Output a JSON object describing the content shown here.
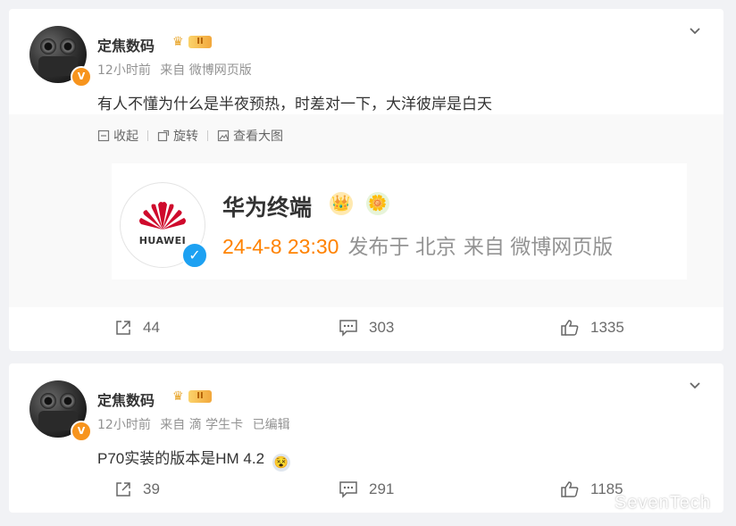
{
  "posts": [
    {
      "author": "定焦数码",
      "level_badge": "II",
      "verify_badge": "V",
      "meta": {
        "time": "12小时前",
        "source": "来自 微博网页版"
      },
      "text": "有人不懂为什么是半夜预热，时差对一下，大洋彼岸是白天",
      "toolbar": {
        "collect": "收起",
        "rotate": "旋转",
        "view_large": "查看大图"
      },
      "embed": {
        "name": "华为终端",
        "logo_text": "HUAWEI",
        "time": "24-4-8 23:30",
        "location": "发布于 北京",
        "source": "来自 微博网页版"
      },
      "actions": {
        "reposts": "44",
        "comments": "303",
        "likes": "1335"
      }
    },
    {
      "author": "定焦数码",
      "level_badge": "II",
      "verify_badge": "V",
      "meta": {
        "time": "12小时前",
        "source": "来自 滴 学生卡",
        "edited": "已编辑"
      },
      "text": "P70实装的版本是HM 4.2",
      "actions": {
        "reposts": "39",
        "comments": "291",
        "likes": "1185"
      }
    }
  ],
  "watermark": "SevenTech",
  "colors": {
    "accent_orange": "#ff8200",
    "meta_gray": "#939393",
    "verify_blue": "#1da1f2",
    "huawei_red": "#cf0a2c"
  }
}
